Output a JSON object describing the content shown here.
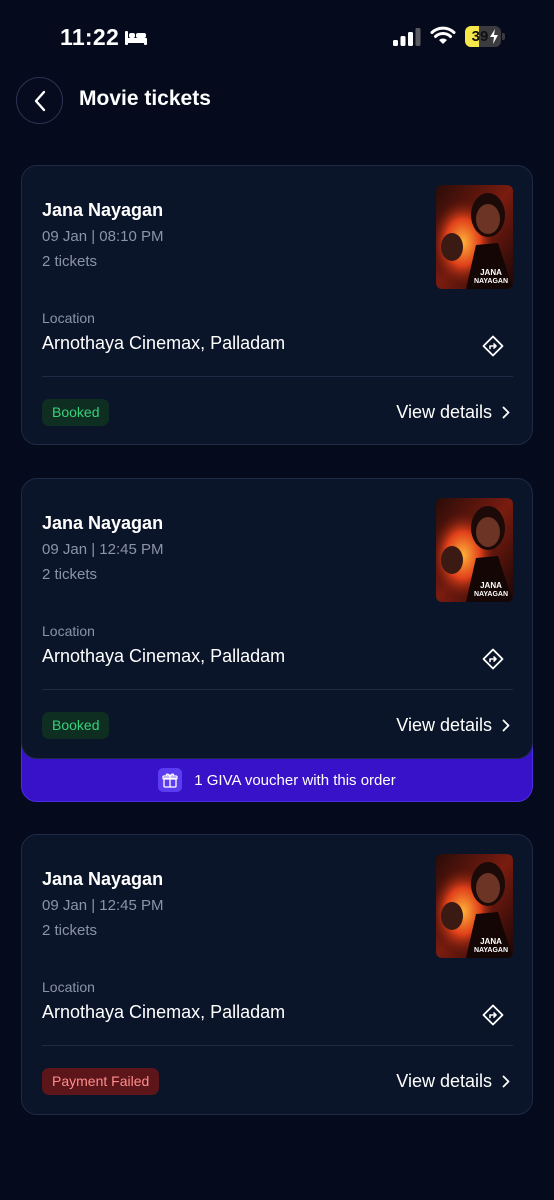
{
  "status_bar": {
    "time": "11:22",
    "battery_level": "39",
    "battery_fraction": 0.39
  },
  "header": {
    "title": "Movie tickets"
  },
  "tickets": [
    {
      "movie": "Jana Nayagan",
      "show_time": "09 Jan | 08:10 PM",
      "tickets": "2 tickets",
      "location_label": "Location",
      "location": "Arnothaya Cinemax, Palladam",
      "status": "Booked",
      "view_details": "View details",
      "poster_text": "JANA NAYAGAN"
    },
    {
      "movie": "Jana Nayagan",
      "show_time": "09 Jan | 12:45 PM",
      "tickets": "2 tickets",
      "location_label": "Location",
      "location": "Arnothaya Cinemax, Palladam",
      "status": "Booked",
      "view_details": "View details",
      "poster_text": "JANA NAYAGAN",
      "voucher": "1 GIVA voucher with this order"
    },
    {
      "movie": "Jana Nayagan",
      "show_time": "09 Jan | 12:45 PM",
      "tickets": "2 tickets",
      "location_label": "Location",
      "location": "Arnothaya Cinemax, Palladam",
      "status": "Payment Failed",
      "view_details": "View details",
      "poster_text": "JANA NAYAGAN"
    }
  ],
  "colors": {
    "background": "#060a1d",
    "card": "#0b1529",
    "booked": "#35d27a",
    "failed": "#ff8d8d",
    "voucher": "#3712c9"
  }
}
